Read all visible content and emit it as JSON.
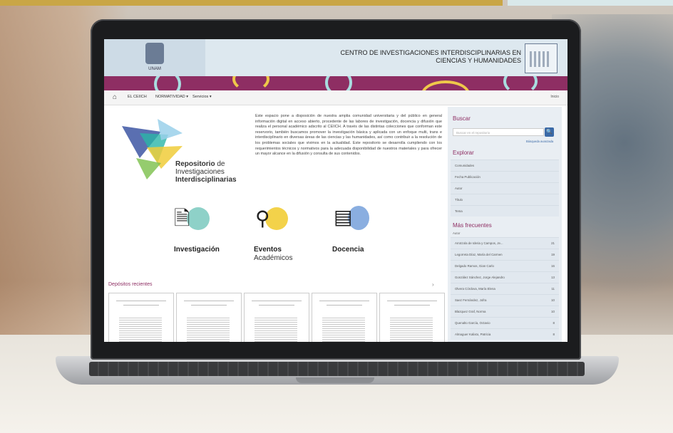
{
  "header": {
    "unam_label": "UNAM",
    "center_title_line1": "CENTRO DE INVESTIGACIONES INTERDISCIPLINARIAS EN",
    "center_title_line2": "CIENCIAS Y HUMANIDADES"
  },
  "nav": {
    "items": [
      "EL CEIICH",
      "NORMATIVIDAD ▾",
      "Servicios ▾"
    ],
    "login": "Inicio"
  },
  "repo": {
    "title_bold": "Repositorio",
    "title_rest": " de",
    "line2": "Investigaciones",
    "line3": "Interdisciplinarias"
  },
  "intro_text": "Este espacio pone a disposición de nuestra amplia comunidad universitaria y del público en general información digital en acceso abierto, procedente de las labores de investigación, docencia y difusión que realiza el personal académico adscrito al CEIICH. A través de las distintas colecciones que conforman este reservorio, también buscamos promover la investigación básica y aplicada con un enfoque multi, trans e interdisciplinario en diversas áreas de las ciencias y las humanidades, así como contribuir a la resolución de los problemas sociales que vivimos en la actualidad. Este repositorio se desarrolla cumpliendo con los requerimientos técnicos y normativos para la adecuada disponibilidad de nuestros materiales y para ofrecer un mayor alcance en la difusión y consulta de sus contenidos.",
  "features": [
    {
      "label": "Investigación",
      "label2": "",
      "icon": "document-search-icon"
    },
    {
      "label": "Eventos",
      "label2": "Académicos",
      "icon": "lecture-icon"
    },
    {
      "label": "Docencia",
      "label2": "",
      "icon": "books-icon"
    }
  ],
  "recent": {
    "title": "Depósitos recientes",
    "arrow": "›"
  },
  "sidebar": {
    "search_heading": "Buscar",
    "search_placeholder": "Buscar en el repositorio",
    "search_button": "🔍",
    "advanced": "Búsqueda avanzada",
    "explore_heading": "Explorar",
    "explore_items": [
      "Comunidades",
      "Fecha Publicación",
      "Autor",
      "Título",
      "Tema"
    ],
    "frequent_heading": "Más frecuentes",
    "frequent_sub": "Autor",
    "frequent_items": [
      {
        "name": "Arrotzola de Ideria y Campos, Je...",
        "count": "21"
      },
      {
        "name": "Legorreta Díaz, María del Carmen",
        "count": "19"
      },
      {
        "name": "Delgado Ramos, Gian Carlo",
        "count": "16"
      },
      {
        "name": "González Sánchez, Jorge Alejandro",
        "count": "13"
      },
      {
        "name": "Olvera Córdova, María Elena",
        "count": "11"
      },
      {
        "name": "Saez Fernández, Jofra",
        "count": "10"
      },
      {
        "name": "Blazquez Graf, Norma",
        "count": "10"
      },
      {
        "name": "Quenalto García, Octavio",
        "count": "8"
      },
      {
        "name": "Almaguer Kalixto, Patricia",
        "count": "8"
      }
    ]
  }
}
